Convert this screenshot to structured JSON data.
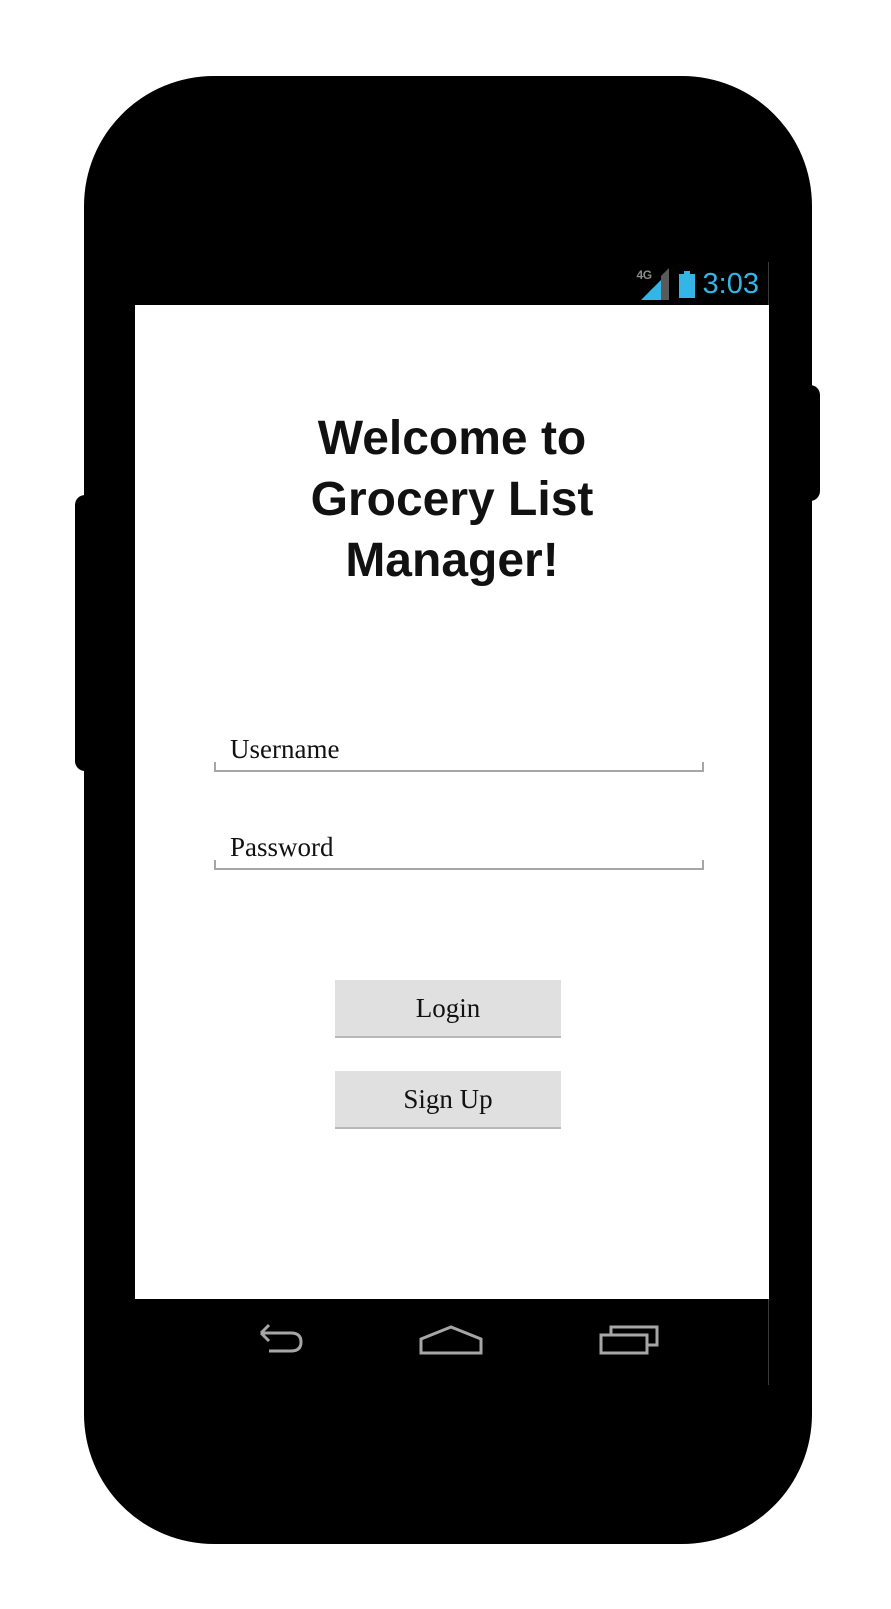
{
  "status_bar": {
    "network_label": "4G",
    "time": "3:03",
    "time_color": "#33b5e5",
    "battery_color": "#33b5e5",
    "icons": [
      "signal-icon",
      "battery-icon"
    ]
  },
  "login_screen": {
    "title_lines": [
      "Welcome to",
      "Grocery List",
      "Manager!"
    ],
    "username_placeholder": "Username",
    "password_placeholder": "Password",
    "login_label": "Login",
    "signup_label": "Sign Up"
  },
  "nav_bar": {
    "icons": [
      "back-icon",
      "home-icon",
      "recent-apps-icon"
    ],
    "icon_color": "#a6a6a6"
  },
  "device": {
    "body_color": "#000000",
    "button_color": "#e0e0e0"
  }
}
